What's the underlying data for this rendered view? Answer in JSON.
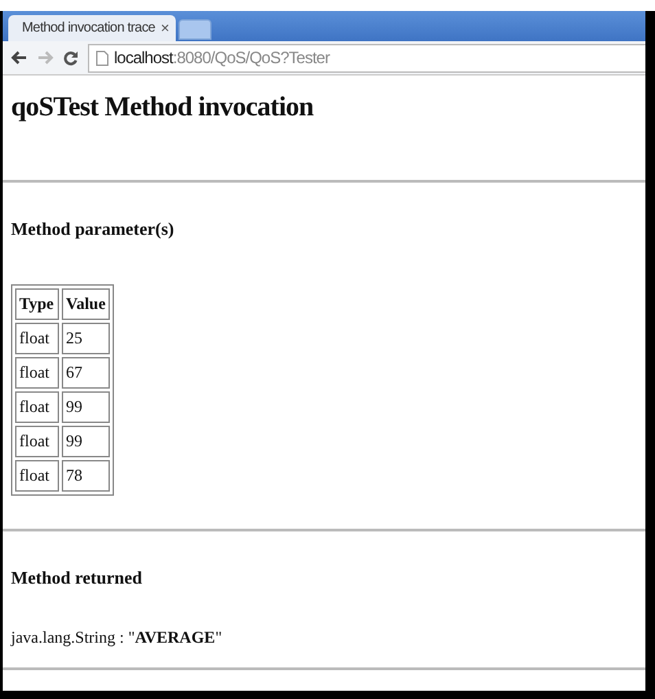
{
  "browser": {
    "tab": {
      "title": "Method invocation trace",
      "close": "×"
    },
    "address": {
      "host": "localhost",
      "path": ":8080/QoS/QoS?Tester"
    }
  },
  "page": {
    "title": "qoSTest Method invocation",
    "parameters": {
      "heading": "Method parameter(s)",
      "columns": [
        "Type",
        "Value"
      ],
      "rows": [
        [
          "float",
          "25"
        ],
        [
          "float",
          "67"
        ],
        [
          "float",
          "99"
        ],
        [
          "float",
          "99"
        ],
        [
          "float",
          "78"
        ]
      ]
    },
    "returned": {
      "heading": "Method returned",
      "value": "java.lang.String : \"**AVERAGE**\""
    }
  }
}
